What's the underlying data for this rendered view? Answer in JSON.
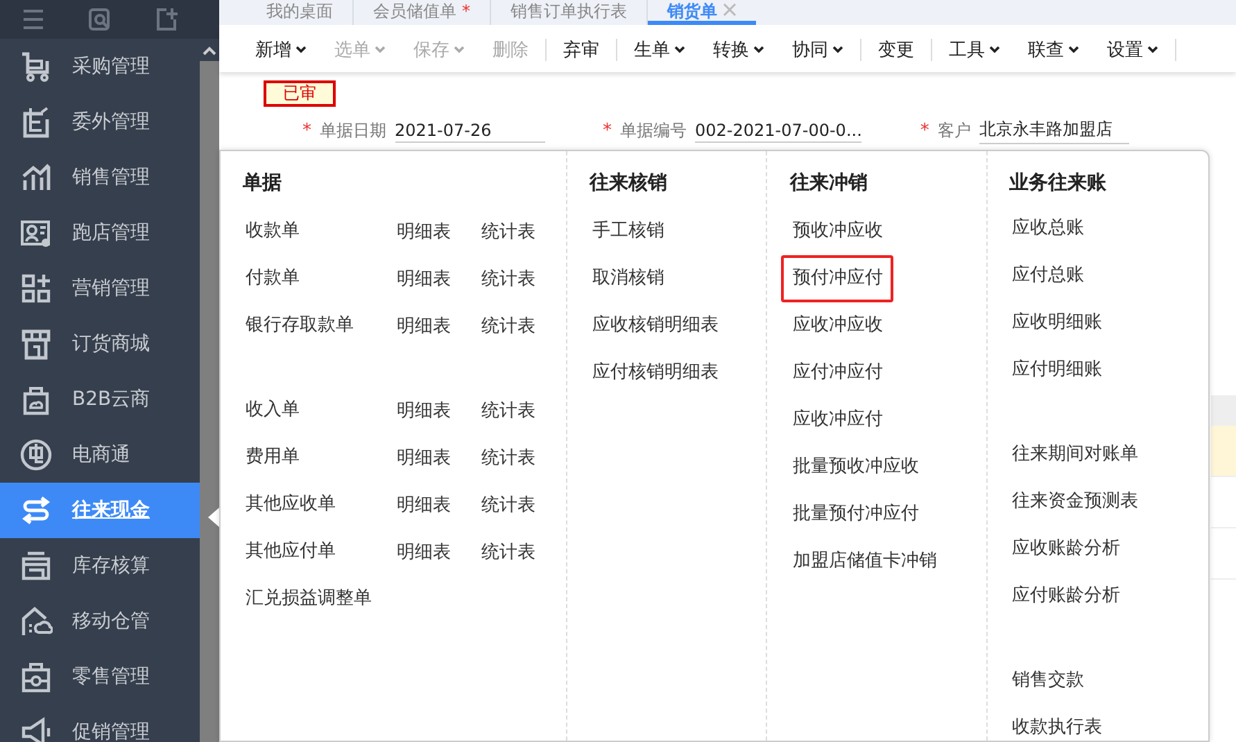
{
  "sidebar": {
    "items": [
      {
        "label": "采购管理",
        "selected": false
      },
      {
        "label": "委外管理",
        "selected": false
      },
      {
        "label": "销售管理",
        "selected": false
      },
      {
        "label": "跑店管理",
        "selected": false
      },
      {
        "label": "营销管理",
        "selected": false
      },
      {
        "label": "订货商城",
        "selected": false
      },
      {
        "label": "B2B云商",
        "selected": false
      },
      {
        "label": "电商通",
        "selected": false
      },
      {
        "label": "往来现金",
        "selected": true
      },
      {
        "label": "库存核算",
        "selected": false
      },
      {
        "label": "移动仓管",
        "selected": false
      },
      {
        "label": "零售管理",
        "selected": false
      },
      {
        "label": "促销管理",
        "selected": false
      }
    ]
  },
  "tabs": [
    {
      "label": "我的桌面",
      "selected": false,
      "closable": false
    },
    {
      "label": "会员储值单",
      "marker": "*",
      "selected": false,
      "closable": false
    },
    {
      "label": "销售订单执行表",
      "selected": false,
      "closable": false
    },
    {
      "label": "销货单",
      "selected": true,
      "closable": true
    }
  ],
  "toolbar": [
    {
      "label": "新增",
      "dropdown": true,
      "disabled": false,
      "separator_before": false
    },
    {
      "label": "选单",
      "dropdown": true,
      "disabled": true,
      "separator_before": false
    },
    {
      "label": "保存",
      "dropdown": true,
      "disabled": true,
      "separator_before": false
    },
    {
      "label": "删除",
      "dropdown": false,
      "disabled": true,
      "separator_before": false
    },
    {
      "label": "弃审",
      "dropdown": false,
      "disabled": false,
      "separator_before": true
    },
    {
      "label": "生单",
      "dropdown": true,
      "disabled": false,
      "separator_before": true
    },
    {
      "label": "转换",
      "dropdown": true,
      "disabled": false,
      "separator_before": false
    },
    {
      "label": "协同",
      "dropdown": true,
      "disabled": false,
      "separator_before": false
    },
    {
      "label": "变更",
      "dropdown": false,
      "disabled": false,
      "separator_before": true
    },
    {
      "label": "工具",
      "dropdown": true,
      "disabled": false,
      "separator_before": true
    },
    {
      "label": "联查",
      "dropdown": true,
      "disabled": false,
      "separator_before": false
    },
    {
      "label": "设置",
      "dropdown": true,
      "disabled": false,
      "separator_before": false
    }
  ],
  "status_badge": "已审",
  "form": [
    {
      "required_mark": "*",
      "label": "单据日期",
      "value": "2021-07-26"
    },
    {
      "required_mark": "*",
      "label": "单据编号",
      "value": "002-2021-07-00-0..."
    },
    {
      "required_mark": "*",
      "label": "客户",
      "value": "北京永丰路加盟店"
    }
  ],
  "menu": {
    "columns": [
      {
        "title": "单据",
        "groups": [
          [
            {
              "label": "收款单",
              "highlighted": false,
              "links": [
                "明细表",
                "统计表"
              ]
            },
            {
              "label": "付款单",
              "highlighted": false,
              "links": [
                "明细表",
                "统计表"
              ]
            },
            {
              "label": "银行存取款单",
              "highlighted": false,
              "links": [
                "明细表",
                "统计表"
              ]
            }
          ],
          [
            {
              "label": "收入单",
              "highlighted": false,
              "links": [
                "明细表",
                "统计表"
              ]
            },
            {
              "label": "费用单",
              "highlighted": false,
              "links": [
                "明细表",
                "统计表"
              ]
            },
            {
              "label": "其他应收单",
              "highlighted": false,
              "links": [
                "明细表",
                "统计表"
              ]
            },
            {
              "label": "其他应付单",
              "highlighted": false,
              "links": [
                "明细表",
                "统计表"
              ]
            },
            {
              "label": "汇兑损益调整单",
              "highlighted": false
            }
          ]
        ]
      },
      {
        "title": "往来核销",
        "groups": [
          [
            {
              "label": "手工核销",
              "highlighted": false
            },
            {
              "label": "取消核销",
              "highlighted": false
            },
            {
              "label": "应收核销明细表",
              "highlighted": false
            },
            {
              "label": "应付核销明细表",
              "highlighted": false
            }
          ]
        ]
      },
      {
        "title": "往来冲销",
        "groups": [
          [
            {
              "label": "预收冲应收",
              "highlighted": false
            },
            {
              "label": "预付冲应付",
              "highlighted": true
            },
            {
              "label": "应收冲应收",
              "highlighted": false
            },
            {
              "label": "应付冲应付",
              "highlighted": false
            },
            {
              "label": "应收冲应付",
              "highlighted": false
            },
            {
              "label": "批量预收冲应收",
              "highlighted": false
            },
            {
              "label": "批量预付冲应付",
              "highlighted": false
            },
            {
              "label": "加盟店储值卡冲销",
              "highlighted": false
            }
          ]
        ]
      },
      {
        "title": "业务往来账",
        "groups": [
          [
            {
              "label": "应收总账",
              "highlighted": false
            },
            {
              "label": "应付总账",
              "highlighted": false
            },
            {
              "label": "应收明细账",
              "highlighted": false
            },
            {
              "label": "应付明细账",
              "highlighted": false
            }
          ],
          [
            {
              "label": "往来期间对账单",
              "highlighted": false
            },
            {
              "label": "往来资金预测表",
              "highlighted": false
            },
            {
              "label": "应收账龄分析",
              "highlighted": false
            },
            {
              "label": "应付账龄分析",
              "highlighted": false
            }
          ],
          [
            {
              "label": "销售交款",
              "highlighted": false
            },
            {
              "label": "收款执行表",
              "highlighted": false
            }
          ]
        ]
      }
    ]
  }
}
